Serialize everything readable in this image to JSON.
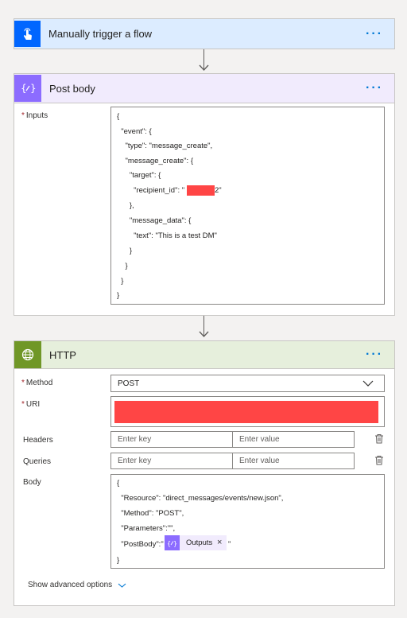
{
  "trigger": {
    "title": "Manually trigger a flow",
    "more": "···",
    "color": "#dcecff",
    "icon": "touch-icon"
  },
  "post_body": {
    "title": "Post body",
    "more": "···",
    "color": "#f1ebfd",
    "icon": "compose-icon",
    "inputs_required": "*",
    "inputs_label": "Inputs",
    "lines": [
      "{",
      "  \"event\": {",
      "    \"type\": \"message_create\",",
      "    \"message_create\": {",
      "      \"target\": {",
      "        \"recipient_id\": \"",
      "      },",
      "      \"message_data\": {",
      "        \"text\": \"This is a test DM\"",
      "      }",
      "    }",
      "  }",
      "}"
    ],
    "recipient_suffix": "2\""
  },
  "http": {
    "title": "HTTP",
    "more": "···",
    "color": "#e6efdc",
    "icon": "globe-icon",
    "method_required": "*",
    "method_label": "Method",
    "method_value": "POST",
    "uri_required": "*",
    "uri_label": "URI",
    "headers_label": "Headers",
    "headers_key_placeholder": "Enter key",
    "headers_value_placeholder": "Enter value",
    "queries_label": "Queries",
    "queries_key_placeholder": "Enter key",
    "queries_value_placeholder": "Enter value",
    "body_label": "Body",
    "body_lines": [
      "{",
      "  \"Resource\": \"direct_messages/events/new.json\",",
      "  \"Method\": \"POST\",",
      "  \"Parameters\":\"\",",
      "  \"PostBody\":\"",
      "}"
    ],
    "token_label": "Outputs",
    "token_close": "×",
    "after_token": "\"",
    "show_advanced": "Show advanced options"
  }
}
